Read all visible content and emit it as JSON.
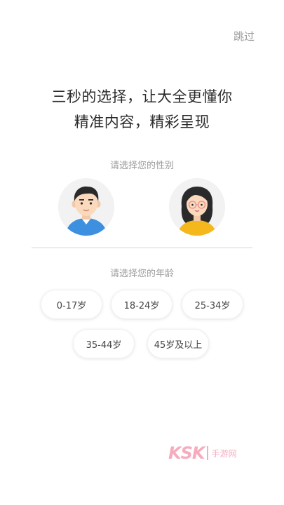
{
  "header": {
    "skip_label": "跳过"
  },
  "headline": {
    "line1": "三秒的选择，让大全更懂你",
    "line2": "精准内容，精彩呈现"
  },
  "gender": {
    "label": "请选择您的性别"
  },
  "age": {
    "label": "请选择您的年龄",
    "options": [
      "0-17岁",
      "18-24岁",
      "25-34岁",
      "35-44岁",
      "45岁及以上"
    ]
  },
  "watermark": {
    "brand": "KSK",
    "sub": "手游网"
  },
  "colors": {
    "male_shirt": "#3d8fe0",
    "female_shirt": "#f4b71c",
    "avatar_bg": "#f2f2f2",
    "watermark": "#f06a8a"
  }
}
